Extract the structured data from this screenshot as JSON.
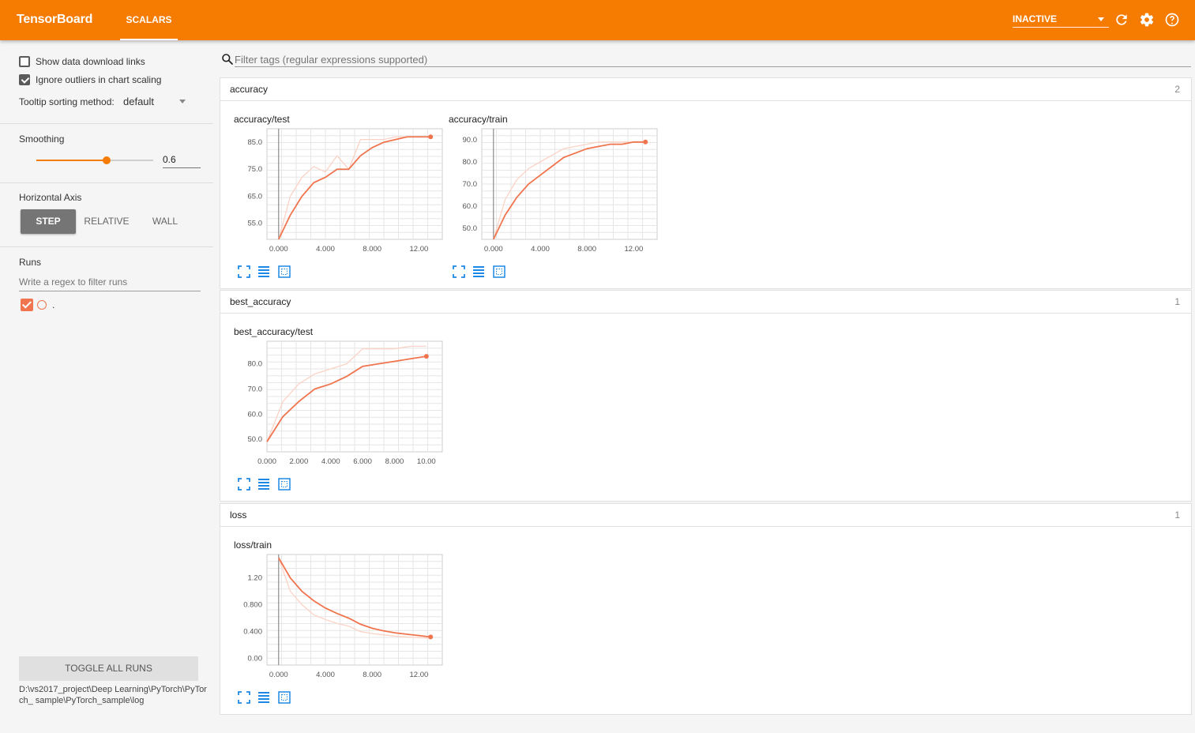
{
  "header": {
    "brand": "TensorBoard",
    "tab": "SCALARS",
    "status": "INACTIVE",
    "icons": [
      "refresh-icon",
      "settings-icon",
      "help-icon"
    ]
  },
  "sidebar": {
    "show_download_links": {
      "label": "Show data download links",
      "checked": false
    },
    "ignore_outliers": {
      "label": "Ignore outliers in chart scaling",
      "checked": true
    },
    "tooltip_label": "Tooltip sorting method:",
    "tooltip_value": "default",
    "smoothing_label": "Smoothing",
    "smoothing_value": "0.6",
    "axis_label": "Horizontal Axis",
    "axis_options": [
      "STEP",
      "RELATIVE",
      "WALL"
    ],
    "axis_selected": "STEP",
    "runs_label": "Runs",
    "runs_filter_placeholder": "Write a regex to filter runs",
    "run_name": ".",
    "toggle_all": "TOGGLE ALL RUNS",
    "logdir": "D:\\vs2017_project\\Deep Learning\\PyTorch\\PyTorch_ sample\\PyTorch_sample\\log"
  },
  "search": {
    "placeholder": "Filter tags (regular expressions supported)"
  },
  "colors": {
    "accent": "#f57c00",
    "series": "#f0744d",
    "series_raw": "#fbd3c6"
  },
  "categories": [
    {
      "title": "accuracy",
      "count": "2"
    },
    {
      "title": "best_accuracy",
      "count": "1"
    },
    {
      "title": "loss",
      "count": "1"
    }
  ],
  "chart_data": [
    {
      "type": "line",
      "title": "accuracy/test",
      "xticks": [
        "0.000",
        "4.000",
        "8.000",
        "12.00"
      ],
      "yticks": [
        "55.0",
        "65.0",
        "75.0",
        "85.0"
      ],
      "xlim": [
        -1,
        14
      ],
      "ylim": [
        49,
        90
      ],
      "x": [
        0,
        1,
        2,
        3,
        4,
        5,
        6,
        7,
        8,
        9,
        10,
        11,
        12,
        13
      ],
      "smoothed": [
        49,
        58,
        65,
        70,
        72,
        75,
        75,
        80,
        83,
        85,
        86,
        87,
        87,
        87
      ],
      "raw": [
        49,
        65,
        72,
        76,
        74,
        80,
        75,
        86,
        86,
        86,
        87,
        87,
        87,
        87
      ]
    },
    {
      "type": "line",
      "title": "accuracy/train",
      "xticks": [
        "0.000",
        "4.000",
        "8.000",
        "12.00"
      ],
      "yticks": [
        "50.0",
        "60.0",
        "70.0",
        "80.0",
        "90.0"
      ],
      "xlim": [
        -1,
        14
      ],
      "ylim": [
        45,
        95
      ],
      "x": [
        0,
        1,
        2,
        3,
        4,
        5,
        6,
        7,
        8,
        9,
        10,
        11,
        12,
        13
      ],
      "smoothed": [
        45,
        56,
        64,
        70,
        74,
        78,
        82,
        84,
        86,
        87,
        88,
        88,
        89,
        89
      ],
      "raw": [
        45,
        63,
        72,
        77,
        80,
        83,
        86,
        87,
        88,
        89,
        89,
        89,
        89,
        89
      ]
    },
    {
      "type": "line",
      "title": "best_accuracy/test",
      "xticks": [
        "0.000",
        "2.000",
        "4.000",
        "6.000",
        "8.000",
        "10.00"
      ],
      "yticks": [
        "50.0",
        "60.0",
        "70.0",
        "80.0"
      ],
      "xlim": [
        0,
        11
      ],
      "ylim": [
        45,
        89
      ],
      "x": [
        0,
        1,
        2,
        3,
        4,
        5,
        6,
        7,
        8,
        9,
        10
      ],
      "smoothed": [
        49,
        59,
        65,
        70,
        72,
        75,
        79,
        80,
        81,
        82,
        83
      ],
      "raw": [
        49,
        65,
        72,
        76,
        78,
        80,
        86,
        86,
        86,
        87,
        87
      ]
    },
    {
      "type": "line",
      "title": "loss/train",
      "xticks": [
        "0.000",
        "4.000",
        "8.000",
        "12.00"
      ],
      "yticks": [
        "0.00",
        "0.400",
        "0.800",
        "1.20"
      ],
      "xlim": [
        -1,
        14
      ],
      "ylim": [
        -0.1,
        1.55
      ],
      "x": [
        0,
        1,
        2,
        3,
        4,
        5,
        6,
        7,
        8,
        9,
        10,
        11,
        12,
        13
      ],
      "smoothed": [
        1.5,
        1.2,
        1.0,
        0.86,
        0.75,
        0.67,
        0.6,
        0.51,
        0.45,
        0.41,
        0.38,
        0.36,
        0.34,
        0.32
      ],
      "raw": [
        1.5,
        1.0,
        0.8,
        0.65,
        0.58,
        0.52,
        0.48,
        0.4,
        0.37,
        0.35,
        0.33,
        0.32,
        0.31,
        0.3
      ]
    }
  ]
}
